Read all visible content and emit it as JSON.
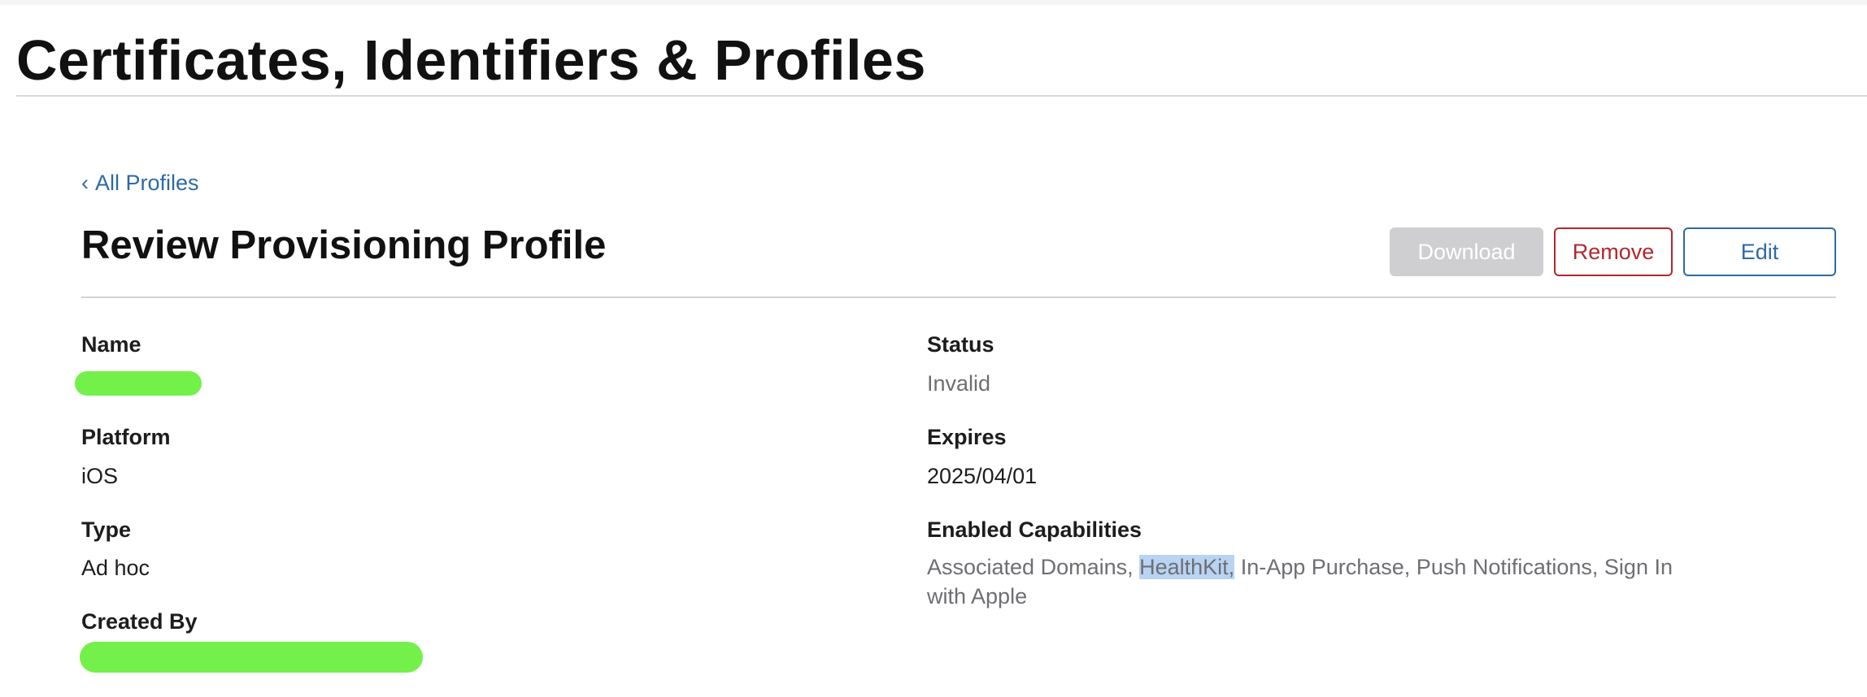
{
  "header": {
    "title": "Certificates, Identifiers & Profiles"
  },
  "nav": {
    "back_link": "All Profiles",
    "back_chevron": "‹"
  },
  "section": {
    "title": "Review Provisioning Profile"
  },
  "actions": {
    "download_label": "Download",
    "remove_label": "Remove",
    "edit_label": "Edit"
  },
  "fields": {
    "name": {
      "label": "Name",
      "value": ""
    },
    "platform": {
      "label": "Platform",
      "value": "iOS"
    },
    "type": {
      "label": "Type",
      "value": "Ad hoc"
    },
    "created_by": {
      "label": "Created By",
      "value": ""
    },
    "status": {
      "label": "Status",
      "value": "Invalid"
    },
    "expires": {
      "label": "Expires",
      "value": "2025/04/01"
    },
    "capabilities": {
      "label": "Enabled Capabilities",
      "before": "Associated Domains, ",
      "highlighted": "HealthKit,",
      "after": " In-App Purchase, Push Notifications, Sign In with Apple"
    }
  },
  "colors": {
    "link": "#2e6aa4",
    "danger": "#b1282c",
    "disabled": "#cfcfd1",
    "redaction": "#74f04b",
    "selection": "#b9d3f3"
  }
}
